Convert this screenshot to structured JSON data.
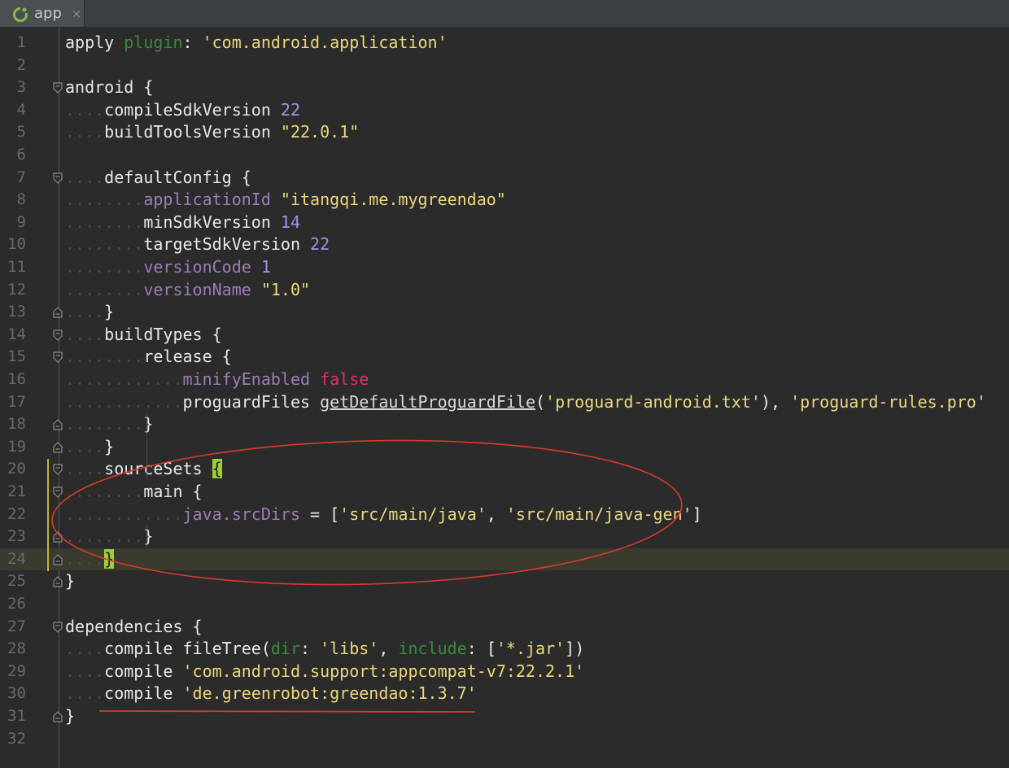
{
  "tab": {
    "label": "app",
    "close": "×",
    "icon": "android-app-icon"
  },
  "lines": [
    {
      "n": "1",
      "fold": "",
      "tokens": [
        {
          "t": "apply ",
          "c": "plain"
        },
        {
          "t": "plugin",
          "c": "param"
        },
        {
          "t": ": ",
          "c": "plain"
        },
        {
          "t": "'com.android.application'",
          "c": "str"
        }
      ]
    },
    {
      "n": "2",
      "fold": "",
      "tokens": []
    },
    {
      "n": "3",
      "fold": "open",
      "tokens": [
        {
          "t": "android {",
          "c": "plain"
        }
      ]
    },
    {
      "n": "4",
      "fold": "",
      "tokens": [
        {
          "t": "....",
          "c": "dots"
        },
        {
          "t": "compileSdkVersion ",
          "c": "plain"
        },
        {
          "t": "22",
          "c": "num"
        }
      ]
    },
    {
      "n": "5",
      "fold": "",
      "tokens": [
        {
          "t": "....",
          "c": "dots"
        },
        {
          "t": "buildToolsVersion ",
          "c": "plain"
        },
        {
          "t": "\"22.0.1\"",
          "c": "str"
        }
      ]
    },
    {
      "n": "6",
      "fold": "",
      "tokens": []
    },
    {
      "n": "7",
      "fold": "open",
      "tokens": [
        {
          "t": "....",
          "c": "dots"
        },
        {
          "t": "defaultConfig {",
          "c": "plain"
        }
      ]
    },
    {
      "n": "8",
      "fold": "",
      "tokens": [
        {
          "t": "........",
          "c": "dots"
        },
        {
          "t": "applicationId ",
          "c": "prop"
        },
        {
          "t": "\"itangqi.me.mygreendao\"",
          "c": "str"
        }
      ]
    },
    {
      "n": "9",
      "fold": "",
      "tokens": [
        {
          "t": "........",
          "c": "dots"
        },
        {
          "t": "minSdkVersion ",
          "c": "plain"
        },
        {
          "t": "14",
          "c": "num"
        }
      ]
    },
    {
      "n": "10",
      "fold": "",
      "tokens": [
        {
          "t": "........",
          "c": "dots"
        },
        {
          "t": "targetSdkVersion ",
          "c": "plain"
        },
        {
          "t": "22",
          "c": "num"
        }
      ]
    },
    {
      "n": "11",
      "fold": "",
      "tokens": [
        {
          "t": "........",
          "c": "dots"
        },
        {
          "t": "versionCode ",
          "c": "prop"
        },
        {
          "t": "1",
          "c": "num"
        }
      ]
    },
    {
      "n": "12",
      "fold": "",
      "tokens": [
        {
          "t": "........",
          "c": "dots"
        },
        {
          "t": "versionName ",
          "c": "prop"
        },
        {
          "t": "\"1.0\"",
          "c": "str"
        }
      ]
    },
    {
      "n": "13",
      "fold": "close",
      "tokens": [
        {
          "t": "....",
          "c": "dots"
        },
        {
          "t": "}",
          "c": "plain"
        }
      ]
    },
    {
      "n": "14",
      "fold": "open",
      "tokens": [
        {
          "t": "....",
          "c": "dots"
        },
        {
          "t": "buildTypes {",
          "c": "plain"
        }
      ]
    },
    {
      "n": "15",
      "fold": "open",
      "tokens": [
        {
          "t": "........",
          "c": "dots"
        },
        {
          "t": "release {",
          "c": "plain"
        }
      ]
    },
    {
      "n": "16",
      "fold": "",
      "tokens": [
        {
          "t": "............",
          "c": "dots"
        },
        {
          "t": "minifyEnabled ",
          "c": "prop"
        },
        {
          "t": "false",
          "c": "bool"
        }
      ]
    },
    {
      "n": "17",
      "fold": "",
      "tokens": [
        {
          "t": "............",
          "c": "dots"
        },
        {
          "t": "proguardFiles ",
          "c": "plain"
        },
        {
          "t": "getDefaultProguardFile",
          "c": "method"
        },
        {
          "t": "(",
          "c": "plain"
        },
        {
          "t": "'proguard-android.txt'",
          "c": "str"
        },
        {
          "t": "), ",
          "c": "plain"
        },
        {
          "t": "'proguard-rules.pro'",
          "c": "str"
        }
      ]
    },
    {
      "n": "18",
      "fold": "close",
      "tokens": [
        {
          "t": "........",
          "c": "dots"
        },
        {
          "t": "}",
          "c": "plain"
        }
      ]
    },
    {
      "n": "19",
      "fold": "close",
      "tokens": [
        {
          "t": "....",
          "c": "dots"
        },
        {
          "t": "}",
          "c": "plain"
        }
      ]
    },
    {
      "n": "20",
      "fold": "open",
      "tokens": [
        {
          "t": "....",
          "c": "dots"
        },
        {
          "t": "sourceSets ",
          "c": "plain"
        },
        {
          "t": "{",
          "c": "bracehl"
        }
      ]
    },
    {
      "n": "21",
      "fold": "open",
      "tokens": [
        {
          "t": "........",
          "c": "dots"
        },
        {
          "t": "main {",
          "c": "plain"
        }
      ]
    },
    {
      "n": "22",
      "fold": "",
      "tokens": [
        {
          "t": "............",
          "c": "dots"
        },
        {
          "t": "java.srcDirs",
          "c": "prop"
        },
        {
          "t": " = ",
          "c": "plain"
        },
        {
          "t": "[",
          "c": "plain"
        },
        {
          "t": "'src/main/java'",
          "c": "str"
        },
        {
          "t": ", ",
          "c": "plain"
        },
        {
          "t": "'src/main/java-gen'",
          "c": "str"
        },
        {
          "t": "]",
          "c": "plain"
        }
      ]
    },
    {
      "n": "23",
      "fold": "close",
      "tokens": [
        {
          "t": "........",
          "c": "dots"
        },
        {
          "t": "}",
          "c": "plain"
        }
      ]
    },
    {
      "n": "24",
      "fold": "close",
      "tokens": [
        {
          "t": "....",
          "c": "dots"
        },
        {
          "t": "}",
          "c": "bracehl"
        }
      ],
      "current": true
    },
    {
      "n": "25",
      "fold": "close",
      "tokens": [
        {
          "t": "}",
          "c": "plain"
        }
      ]
    },
    {
      "n": "26",
      "fold": "",
      "tokens": []
    },
    {
      "n": "27",
      "fold": "open",
      "tokens": [
        {
          "t": "dependencies {",
          "c": "plain"
        }
      ]
    },
    {
      "n": "28",
      "fold": "",
      "tokens": [
        {
          "t": "....",
          "c": "dots"
        },
        {
          "t": "compile ",
          "c": "plain"
        },
        {
          "t": "fileTree(",
          "c": "plain"
        },
        {
          "t": "dir",
          "c": "param"
        },
        {
          "t": ": ",
          "c": "plain"
        },
        {
          "t": "'libs'",
          "c": "str"
        },
        {
          "t": ", ",
          "c": "plain"
        },
        {
          "t": "include",
          "c": "param"
        },
        {
          "t": ": [",
          "c": "plain"
        },
        {
          "t": "'*.jar'",
          "c": "str"
        },
        {
          "t": "])",
          "c": "plain"
        }
      ]
    },
    {
      "n": "29",
      "fold": "",
      "tokens": [
        {
          "t": "....",
          "c": "dots"
        },
        {
          "t": "compile ",
          "c": "plain"
        },
        {
          "t": "'com.android.support:appcompat-v7:22.2.1'",
          "c": "str"
        }
      ]
    },
    {
      "n": "30",
      "fold": "",
      "tokens": [
        {
          "t": "....",
          "c": "dots"
        },
        {
          "t": "compile ",
          "c": "plain"
        },
        {
          "t": "'de.greenrobot:greendao:1.3.7'",
          "c": "str"
        }
      ]
    },
    {
      "n": "31",
      "fold": "close",
      "tokens": [
        {
          "t": "}",
          "c": "plain"
        }
      ]
    },
    {
      "n": "32",
      "fold": "",
      "tokens": []
    }
  ],
  "annotations": {
    "ellipse_color": "#d83a2a",
    "underline_color": "#d83a2a"
  }
}
